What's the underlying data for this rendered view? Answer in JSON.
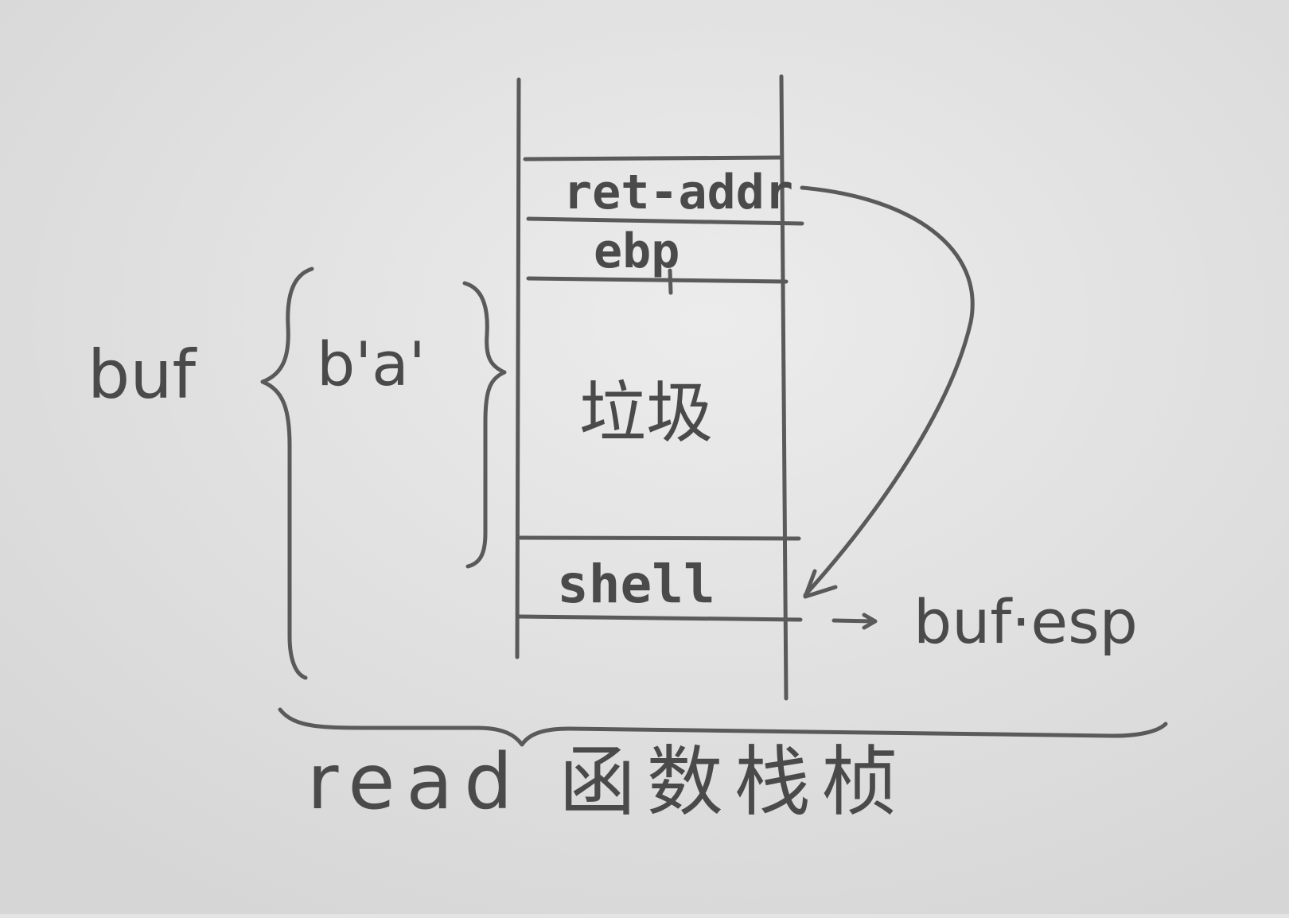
{
  "diagram": {
    "cells": {
      "ret_addr": "ret-addr",
      "ebp": "ebp",
      "junk": "垃圾",
      "shell": "shell"
    },
    "labels": {
      "buf": "buf",
      "payload": "b'a'",
      "buf_esp": "buf·esp",
      "arrow": "→",
      "caption": "read 函数栈桢"
    }
  },
  "colors": {
    "paper": "#e4e4e4",
    "pencil": "#4a4a4a"
  }
}
